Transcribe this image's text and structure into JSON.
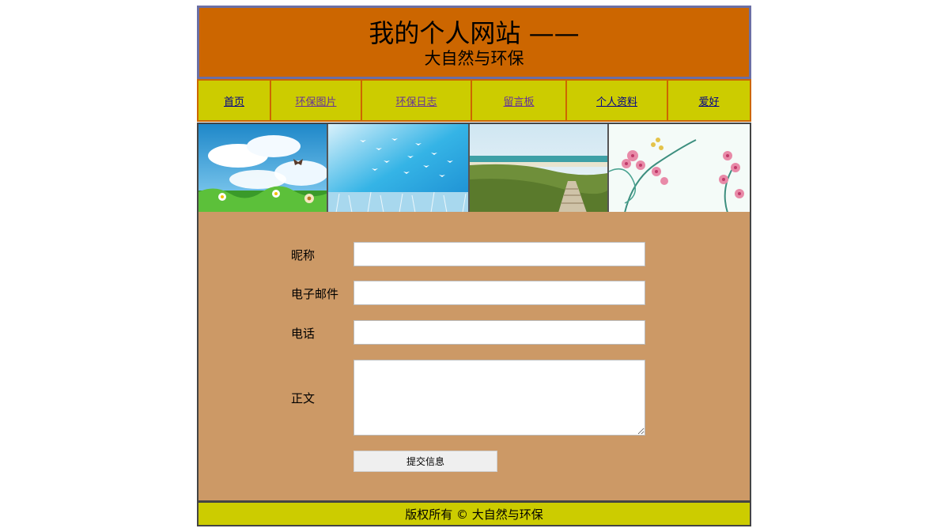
{
  "header": {
    "title": "我的个人网站 ——",
    "subtitle": "大自然与环保"
  },
  "nav": {
    "items": [
      {
        "label": "首页"
      },
      {
        "label": "环保图片"
      },
      {
        "label": "环保日志"
      },
      {
        "label": "留言板"
      },
      {
        "label": "个人资料"
      },
      {
        "label": "爱好"
      }
    ]
  },
  "banner": {
    "images": [
      {
        "subject": "butterfly-meadow-picture"
      },
      {
        "subject": "birds-sky-picture"
      },
      {
        "subject": "coast-boardwalk-picture"
      },
      {
        "subject": "pink-flowers-picture"
      }
    ]
  },
  "form": {
    "nickname_label": "昵称",
    "nickname_value": "",
    "email_label": "电子邮件",
    "email_value": "",
    "phone_label": "电话",
    "phone_value": "",
    "message_label": "正文",
    "message_value": "",
    "submit_label": "提交信息"
  },
  "footer": {
    "text": "版权所有 © 大自然与环保"
  },
  "colors": {
    "header_bg": "#cc6600",
    "nav_bg": "#cccc00",
    "content_bg": "#cc9966",
    "footer_bg": "#cccc00"
  }
}
